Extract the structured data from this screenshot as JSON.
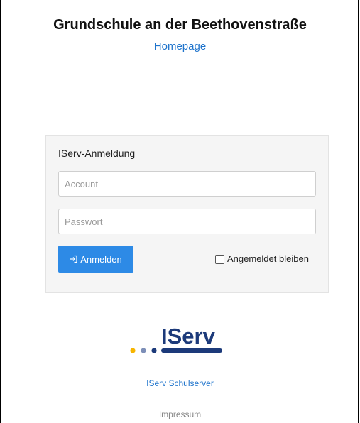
{
  "header": {
    "school_name": "Grundschule an der Beethovenstraße",
    "homepage_link": "Homepage"
  },
  "login": {
    "heading": "IServ-Anmeldung",
    "account_placeholder": "Account",
    "password_placeholder": "Passwort",
    "submit_label": "Anmelden",
    "submit_icon": "sign-in-icon",
    "remember_label": "Angemeldet bleiben",
    "remember_checked": false
  },
  "logo": {
    "name": "iserv-logo",
    "dot_colors": [
      "#f7b500",
      "#7d8fb8",
      "#1c3a7a"
    ],
    "brand_color": "#1c3a7a"
  },
  "footer": {
    "schulserver_link": "IServ Schulserver",
    "impressum_link": "Impressum"
  },
  "colors": {
    "accent": "#2d8ae6",
    "link": "#1f74cc",
    "panel_background": "#f5f5f5"
  }
}
